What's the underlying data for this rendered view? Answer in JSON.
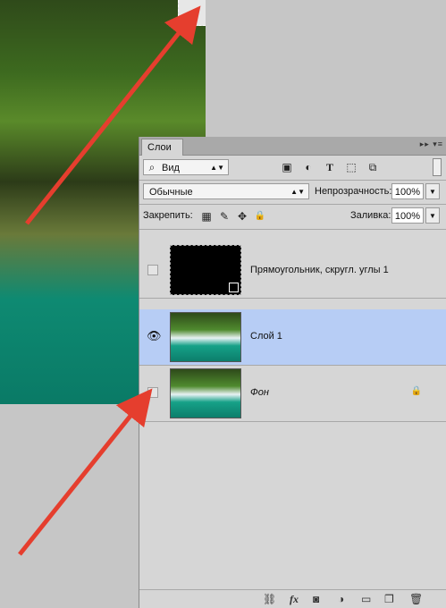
{
  "panel": {
    "tab_label": "Слои",
    "tab_controls": "▸▸ ▾≡",
    "filter_select": "Вид",
    "blend_mode": "Обычные",
    "opacity_label": "Непрозрачность:",
    "opacity_value": "100%",
    "lock_label": "Закрепить:",
    "fill_label": "Заливка:",
    "fill_value": "100%"
  },
  "layers": [
    {
      "name": "Прямоугольник, скругл. углы 1",
      "visible": false,
      "active": false
    },
    {
      "name": "Слой 1",
      "visible": true,
      "active": true
    },
    {
      "name": "Фон",
      "visible": false,
      "active": false,
      "locked": true
    }
  ],
  "icons": {
    "search": "⌕",
    "image": "▣",
    "adjust": "◐",
    "type": "T",
    "shape": "⬚",
    "smart": "⧉",
    "lock_pixels": "▦",
    "lock_brush": "✎",
    "lock_move": "✥",
    "lock_all": "🔒",
    "eye": "👁",
    "link": "⛓",
    "fx": "fx",
    "mask": "◙",
    "adj_layer": "◑",
    "folder": "▭",
    "new_layer": "❐",
    "trash": "🗑"
  },
  "colors": {
    "arrow": "#e53e2e",
    "active_layer": "#b7cdf5"
  }
}
